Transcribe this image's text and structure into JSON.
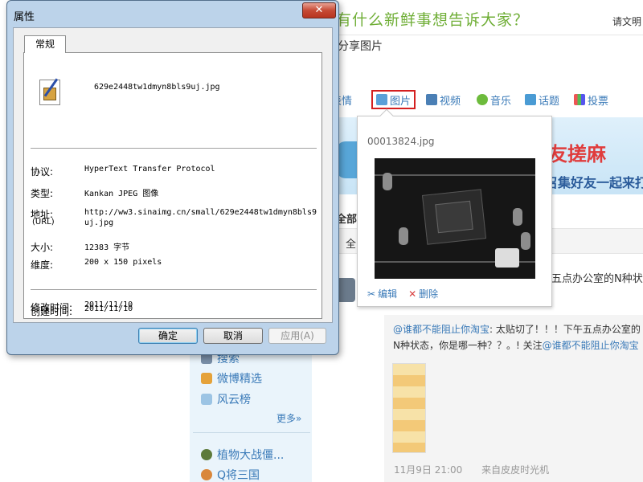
{
  "background": {
    "slogan": "有什么新鲜事想告诉大家？",
    "user_link": "请文明",
    "share_text": "分享图片",
    "toolbar": {
      "emotion": "表情",
      "picture": "图片",
      "video": "视频",
      "music": "音乐",
      "topic": "话题",
      "vote": "投票"
    },
    "banner": {
      "headline": "好友搓麻",
      "subline": "召集好友一起来打"
    },
    "section_header": "全部",
    "section_bar_label": "全",
    "feed_fragment": "五点办公室的N种状",
    "repost": {
      "mention1": "@谁都不能阻止你淘宝",
      "text1": ": 太贴切了！！！下午五点办公室的N种状态，你是哪一种？？。! 关注",
      "mention2": "@谁都不能阻止你淘宝"
    },
    "meta": {
      "time": "11月9日 21:00",
      "source": "来自皮皮时光机"
    },
    "sidebar": {
      "items": [
        "搜索",
        "微博精选",
        "风云榜",
        "植物大战僵...",
        "Q将三国"
      ],
      "more": "更多»"
    }
  },
  "popup": {
    "filename": "00013824.jpg",
    "edit": "编辑",
    "delete": "删除"
  },
  "dialog": {
    "title": "属性",
    "close": "✕",
    "tab": "常规",
    "filename": "629e2448tw1dmyn8bls9uj.jpg",
    "props": {
      "protocol_label": "协议:",
      "protocol_value": "HyperText Transfer Protocol",
      "type_label": "类型:",
      "type_value": "Kankan JPEG 图像",
      "address_label": "地址:",
      "address_sub": "(URL)",
      "address_value": "http://ww3.sinaimg.cn/small/629e2448tw1dmyn8bls9uj.jpg",
      "size_label": "大小:",
      "size_value": "12383 字节",
      "dim_label": "维度:",
      "dim_value": "200  x  150  pixels",
      "created_label": "创建时间:",
      "created_value": "2011/11/10",
      "modified_label": "修改时间:",
      "modified_value": "2011/11/10"
    },
    "buttons": {
      "ok": "确定",
      "cancel": "取消",
      "apply": "应用(A)"
    }
  },
  "colors": {
    "link": "#3a7ab8",
    "slogan": "#6fae36",
    "highlight_border": "#d42020",
    "dialog_frame": "#bcd3ea",
    "close_button": "#c64a35"
  },
  "icons": [
    "emotion-icon",
    "picture-icon",
    "video-icon",
    "music-icon",
    "topic-icon",
    "vote-icon",
    "edit-icon",
    "delete-icon",
    "file-image-icon",
    "close-icon"
  ]
}
